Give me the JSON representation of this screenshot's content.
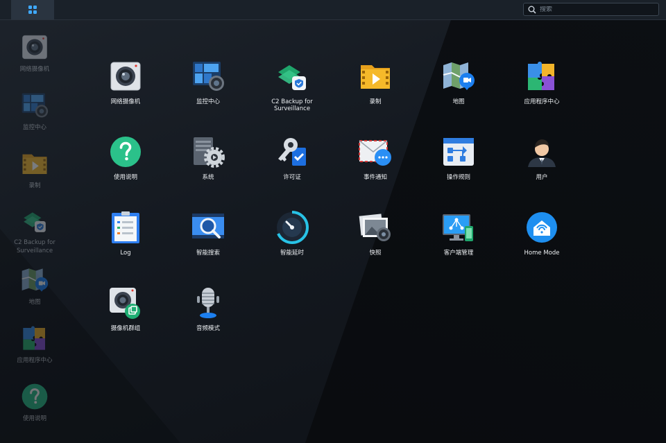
{
  "topbar": {
    "search_placeholder": "搜索",
    "main_menu_icon": "grid-icon"
  },
  "dock": [
    {
      "label": "网络摄像机",
      "icon": "camera-icon"
    },
    {
      "label": "监控中心",
      "icon": "monitor-center-icon"
    },
    {
      "label": "录制",
      "icon": "recording-icon"
    },
    {
      "label": "C2 Backup for\nSurveillance",
      "icon": "c2-backup-icon"
    },
    {
      "label": "地图",
      "icon": "map-icon"
    },
    {
      "label": "应用程序中心",
      "icon": "puzzle-icon"
    },
    {
      "label": "使用说明",
      "icon": "help-icon"
    }
  ],
  "apps": [
    {
      "label": "网络摄像机",
      "icon": "camera-icon"
    },
    {
      "label": "监控中心",
      "icon": "monitor-center-icon"
    },
    {
      "label": "C2 Backup for\nSurveillance",
      "icon": "c2-backup-icon"
    },
    {
      "label": "录制",
      "icon": "recording-icon"
    },
    {
      "label": "地图",
      "icon": "map-icon"
    },
    {
      "label": "应用程序中心",
      "icon": "puzzle-icon"
    },
    {
      "label": "使用说明",
      "icon": "help-icon"
    },
    {
      "label": "系统",
      "icon": "system-gear-icon"
    },
    {
      "label": "许可证",
      "icon": "license-key-icon"
    },
    {
      "label": "事件通知",
      "icon": "notification-mail-icon"
    },
    {
      "label": "操作规则",
      "icon": "action-rules-icon"
    },
    {
      "label": "用户",
      "icon": "user-icon"
    },
    {
      "label": "Log",
      "icon": "log-clipboard-icon"
    },
    {
      "label": "智能搜索",
      "icon": "smart-search-icon"
    },
    {
      "label": "智能延时",
      "icon": "smart-timelapse-icon"
    },
    {
      "label": "快照",
      "icon": "snapshot-icon"
    },
    {
      "label": "客户端管理",
      "icon": "client-management-icon"
    },
    {
      "label": "Home Mode",
      "icon": "home-mode-icon"
    },
    {
      "label": "摄像机群组",
      "icon": "camera-group-icon"
    },
    {
      "label": "音频模式",
      "icon": "microphone-icon"
    }
  ]
}
